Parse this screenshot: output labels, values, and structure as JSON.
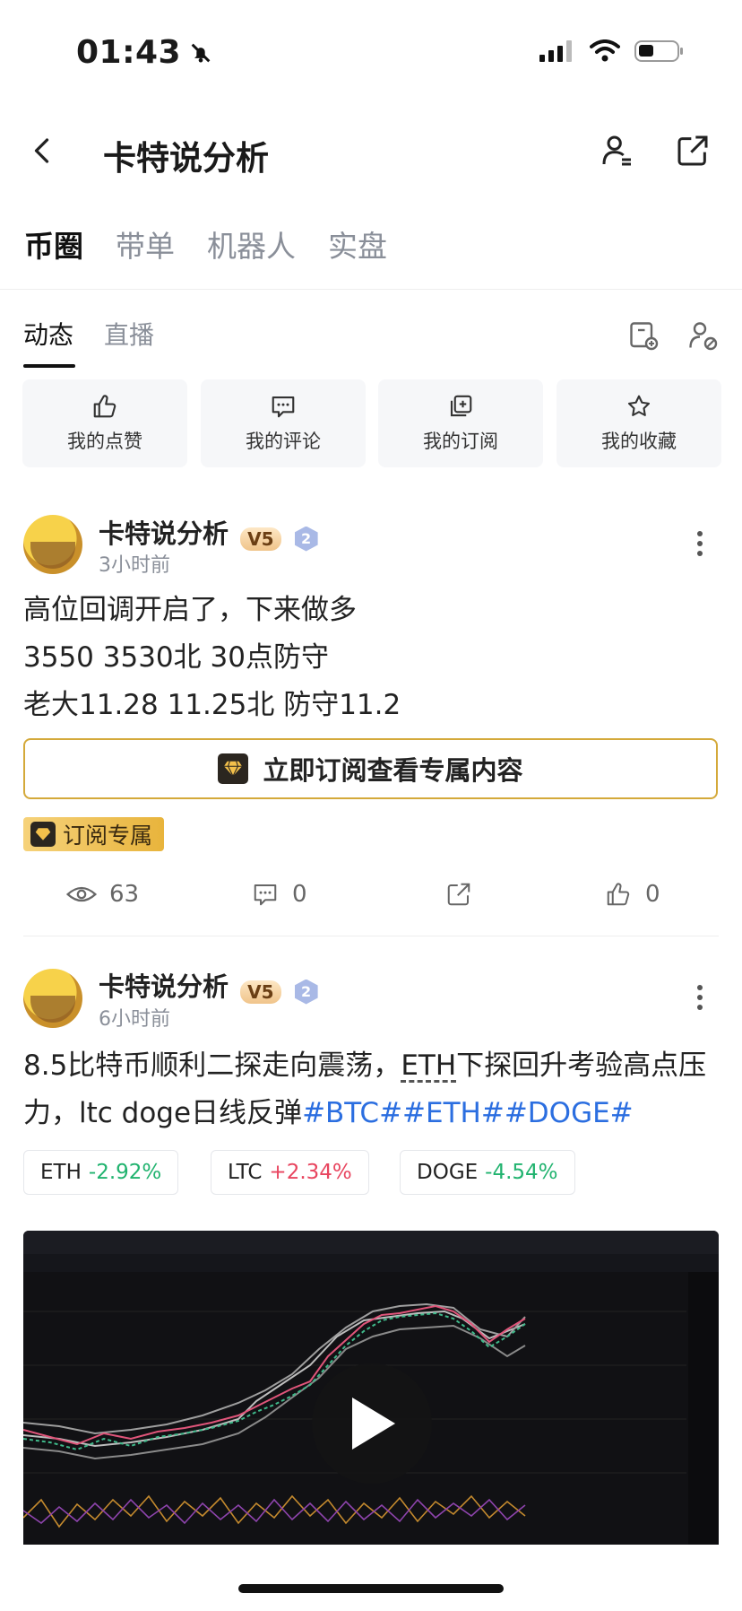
{
  "status": {
    "time": "01:43"
  },
  "nav": {
    "title": "卡特说分析"
  },
  "top_tabs": [
    "币圈",
    "带单",
    "机器人",
    "实盘"
  ],
  "sub_tabs": [
    "动态",
    "直播"
  ],
  "quick_actions": [
    "我的点赞",
    "我的评论",
    "我的订阅",
    "我的收藏"
  ],
  "post1": {
    "author": "卡特说分析",
    "vip": "V5",
    "level": "2",
    "time": "3小时前",
    "lines": [
      "高位回调开启了，下来做多",
      "3550 3530北 30点防守",
      "老大11.28 11.25北 防守11.2"
    ],
    "subscribe_label": "立即订阅查看专属内容",
    "badge": "订阅专属",
    "views": "63",
    "comments": "0",
    "likes": "0"
  },
  "post2": {
    "author": "卡特说分析",
    "vip": "V5",
    "level": "2",
    "time": "6小时前",
    "text_a": "8.5比特币顺利二探走向震荡，",
    "text_eth": "ETH",
    "text_b": "下探回升考验高点压力，ltc doge日线反弹",
    "hashtags": "#BTC##ETH##DOGE#",
    "tickers": [
      {
        "symbol": "ETH",
        "change": "-2.92%"
      },
      {
        "symbol": "LTC",
        "change": "+2.34%"
      },
      {
        "symbol": "DOGE",
        "change": "-4.54%"
      }
    ]
  },
  "colors": {
    "accent_gold": "#d4a93a",
    "down": "#21b36f",
    "up": "#e8455f",
    "hashtag": "#2b6ee0"
  }
}
